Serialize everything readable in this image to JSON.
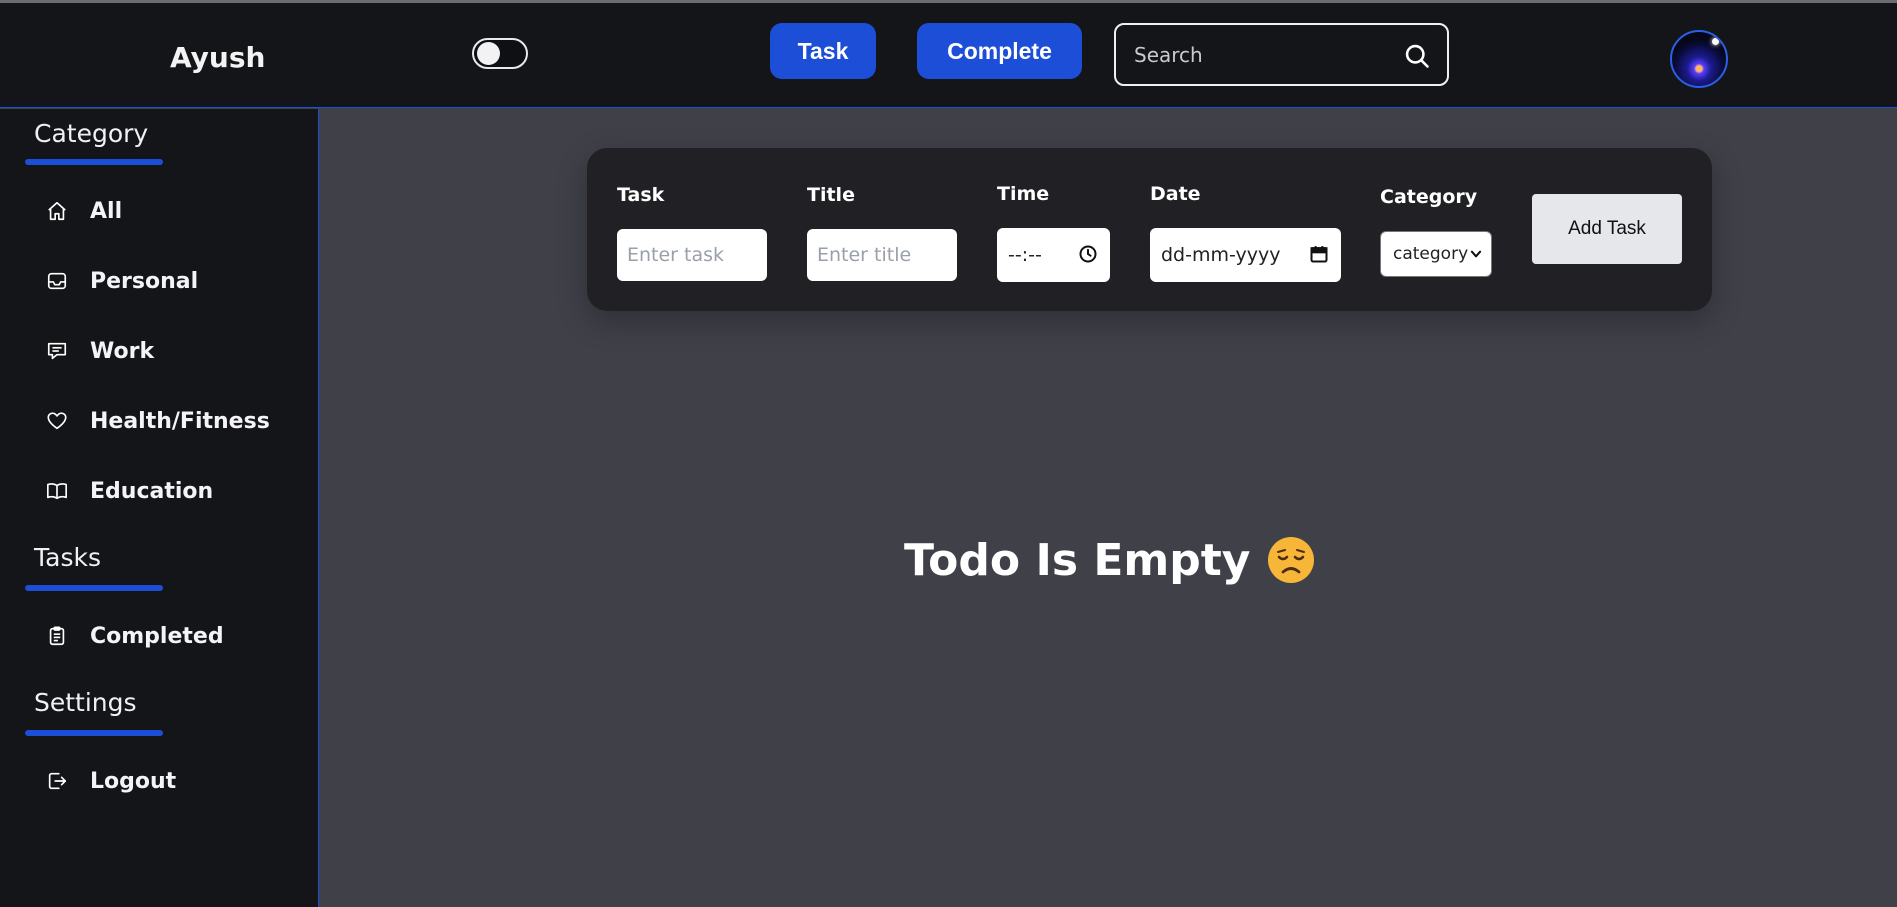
{
  "header": {
    "brand": "Ayush",
    "theme_toggle_on": false,
    "nav": {
      "task_label": "Task",
      "complete_label": "Complete"
    },
    "search": {
      "placeholder": "Search",
      "value": ""
    },
    "avatar_icon": "user-avatar"
  },
  "sidebar": {
    "category_title": "Category",
    "category_items": [
      {
        "label": "All",
        "icon": "home-icon"
      },
      {
        "label": "Personal",
        "icon": "inbox-icon"
      },
      {
        "label": "Work",
        "icon": "message-icon"
      },
      {
        "label": "Health/Fitness",
        "icon": "heart-icon"
      },
      {
        "label": "Education",
        "icon": "book-icon"
      }
    ],
    "tasks_title": "Tasks",
    "tasks_items": [
      {
        "label": "Completed",
        "icon": "clipboard-icon"
      }
    ],
    "settings_title": "Settings",
    "settings_items": [
      {
        "label": "Logout",
        "icon": "logout-icon"
      }
    ]
  },
  "form": {
    "task_label": "Task",
    "task_placeholder": "Enter task",
    "title_label": "Title",
    "title_placeholder": "Enter title",
    "time_label": "Time",
    "time_value": "--:--",
    "date_label": "Date",
    "date_value": "dd-mm-yyyy",
    "category_label": "Category",
    "category_selected": "category",
    "add_button": "Add Task"
  },
  "main": {
    "empty_message": "Todo Is Empty"
  },
  "colors": {
    "accent": "#1d4ed8",
    "background": "#3f4048",
    "sidebar_bg": "#141519",
    "panel_bg": "#212125"
  }
}
